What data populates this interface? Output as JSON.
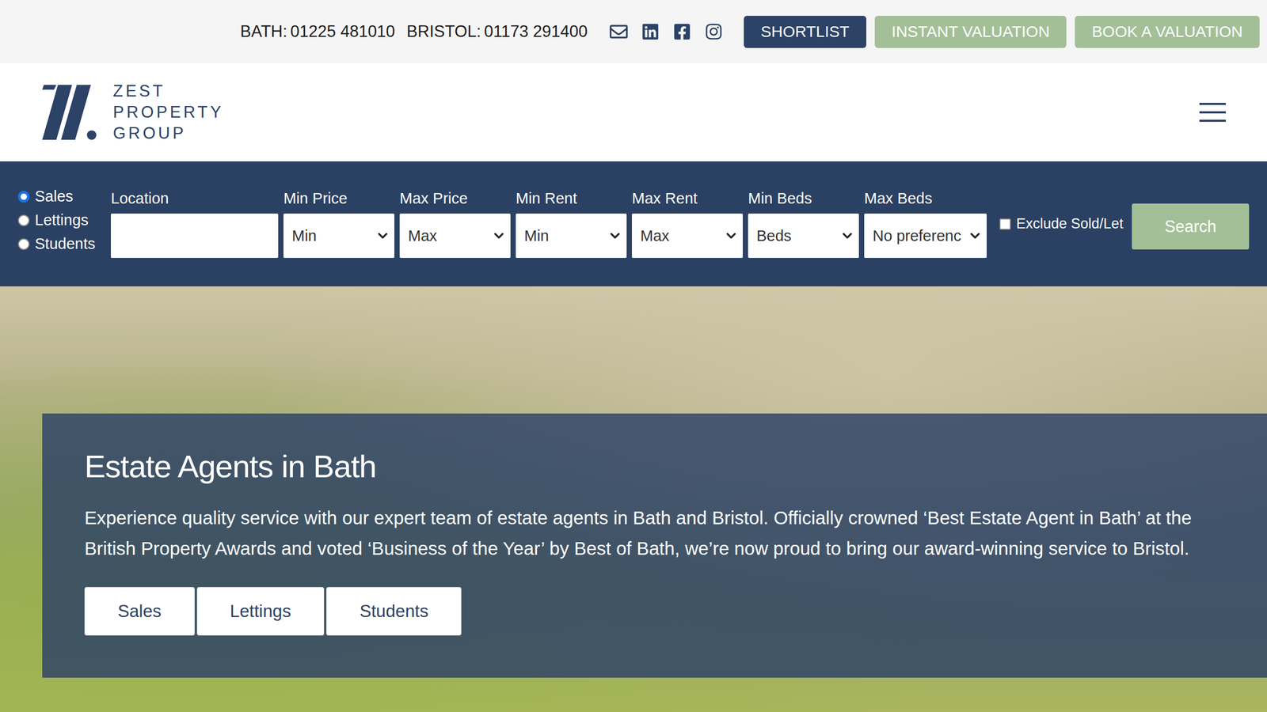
{
  "contacts": [
    {
      "label": "BATH:",
      "phone": "01225 481010"
    },
    {
      "label": "BRISTOL:",
      "phone": "01173 291400"
    }
  ],
  "top_buttons": [
    {
      "label": "SHORTLIST",
      "kind": "primary"
    },
    {
      "label": "INSTANT VALUATION",
      "kind": "secondary"
    },
    {
      "label": "BOOK A VALUATION",
      "kind": "secondary"
    }
  ],
  "logo": {
    "lines": [
      "ZEST",
      "PROPERTY",
      "GROUP"
    ]
  },
  "search": {
    "modes": [
      {
        "label": "Sales",
        "selected": true
      },
      {
        "label": "Lettings",
        "selected": false
      },
      {
        "label": "Students",
        "selected": false
      }
    ],
    "fields": [
      {
        "label": "Location",
        "kind": "text",
        "value": ""
      },
      {
        "label": "Min Price",
        "kind": "select",
        "value": "Min"
      },
      {
        "label": "Max Price",
        "kind": "select",
        "value": "Max"
      },
      {
        "label": "Min Rent",
        "kind": "select",
        "value": "Min"
      },
      {
        "label": "Max Rent",
        "kind": "select",
        "value": "Max"
      },
      {
        "label": "Min Beds",
        "kind": "select",
        "value": "Beds"
      },
      {
        "label": "Max Beds",
        "kind": "select",
        "value": "No preferenc"
      }
    ],
    "exclude": {
      "label": "Exclude Sold/Let",
      "checked": false
    },
    "button": "Search"
  },
  "hero": {
    "title": "Estate Agents in Bath",
    "text": "Experience quality service with our expert team of estate agents in Bath and Bristol. Officially crowned ‘Best Estate Agent in Bath’ at the British Property Awards and voted ‘Business of the Year’ by Best of Bath, we’re now proud to bring our award-winning service to Bristol.",
    "buttons": [
      "Sales",
      "Lettings",
      "Students"
    ]
  }
}
